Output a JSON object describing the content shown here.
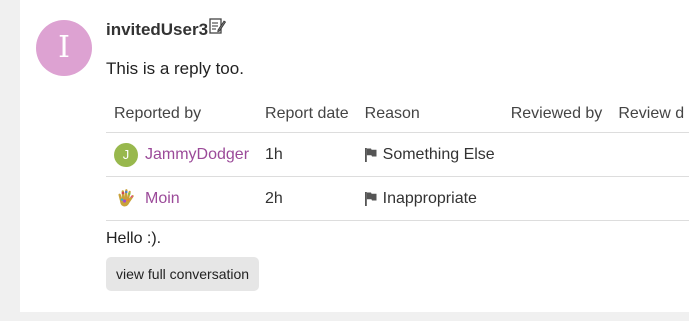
{
  "post": {
    "avatar_letter": "I",
    "avatar_color": "#dda2d2",
    "username": "invitedUser3",
    "text": "This is a reply too."
  },
  "reports": {
    "columns": [
      "Reported by",
      "Report date",
      "Reason",
      "Reviewed by",
      "Review d"
    ],
    "rows": [
      {
        "avatar_letter": "J",
        "avatar_color": "#98b84d",
        "reporter": "JammyDodger",
        "date": "1h",
        "reason": "Something Else",
        "reviewed_by": "",
        "review_date": ""
      },
      {
        "avatar_icon": "hand-avatar-icon",
        "reporter": "Moin",
        "date": "2h",
        "reason": "Inappropriate",
        "reviewed_by": "",
        "review_date": ""
      }
    ]
  },
  "reply": {
    "text": "Hello :)."
  },
  "actions": {
    "view_full_conversation": "view full conversation"
  },
  "colors": {
    "link": "#9b4a99",
    "button_bg": "#e6e6e6"
  }
}
